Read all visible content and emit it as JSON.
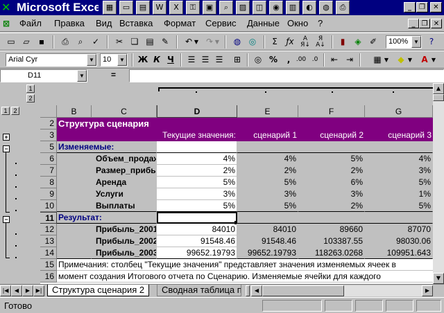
{
  "window": {
    "title": "Microsoft Excel"
  },
  "menu": [
    "Файл",
    "Правка",
    "Вид",
    "Вставка",
    "Формат",
    "Сервис",
    "Данные",
    "Окно",
    "?"
  ],
  "toolbar": {
    "zoom": "100%"
  },
  "format": {
    "font": "Arial Cyr",
    "size": "10",
    "bold": "Ж",
    "italic": "К",
    "underline": "Ч"
  },
  "formula": {
    "cell_ref": "D11",
    "eq": "=",
    "value": ""
  },
  "outline": {
    "levels": [
      "1",
      "2"
    ],
    "top_levels": [
      "1",
      "2"
    ]
  },
  "columns": [
    "B",
    "C",
    "D",
    "E",
    "F",
    "G"
  ],
  "rows": {
    "r2": {
      "num": "2",
      "title": "Структура сценария"
    },
    "r3": {
      "num": "3",
      "d": "Текущие значения:",
      "e": "сценарий 1",
      "f": "сценарий 2",
      "g": "сценарий 3"
    },
    "r5": {
      "num": "5",
      "b": "Изменяемые:"
    },
    "r6": {
      "num": "6",
      "c": "Объем_продаж",
      "d": "4%",
      "e": "4%",
      "f": "5%",
      "g": "4%"
    },
    "r7": {
      "num": "7",
      "c": "Размер_прибыли",
      "d": "2%",
      "e": "2%",
      "f": "2%",
      "g": "3%"
    },
    "r8": {
      "num": "8",
      "c": "Аренда",
      "d": "5%",
      "e": "5%",
      "f": "6%",
      "g": "5%"
    },
    "r9": {
      "num": "9",
      "c": "Услуги",
      "d": "3%",
      "e": "3%",
      "f": "3%",
      "g": "1%"
    },
    "r10": {
      "num": "10",
      "c": "Выплаты",
      "d": "5%",
      "e": "5%",
      "f": "2%",
      "g": "5%"
    },
    "r11": {
      "num": "11",
      "b": "Результат:"
    },
    "r12": {
      "num": "12",
      "c": "Прибыль_2001",
      "d": "84010",
      "e": "84010",
      "f": "89660",
      "g": "87070"
    },
    "r13": {
      "num": "13",
      "c": "Прибыль_2002",
      "d": "91548.46",
      "e": "91548.46",
      "f": "103387.55",
      "g": "98030.06"
    },
    "r14": {
      "num": "14",
      "c": "Прибыль_2003",
      "d": "99652.19793",
      "e": "99652.19793",
      "f": "118263.0268",
      "g": "109951.643"
    },
    "r15": {
      "num": "15",
      "b": "Примечания: столбец \"Текущие значения\" представляет значения изменяемых ячеек в"
    },
    "r16": {
      "num": "16",
      "b": "момент создания Итогового отчета по Сценарию. Изменяемые ячейки для каждого"
    }
  },
  "tabs": [
    "Структура сценария 2",
    "Сводная таблица по сц"
  ],
  "status": "Готово",
  "colors": {
    "title_bg": "#000080",
    "header_fill": "#800080",
    "face": "#c0c0c0"
  }
}
